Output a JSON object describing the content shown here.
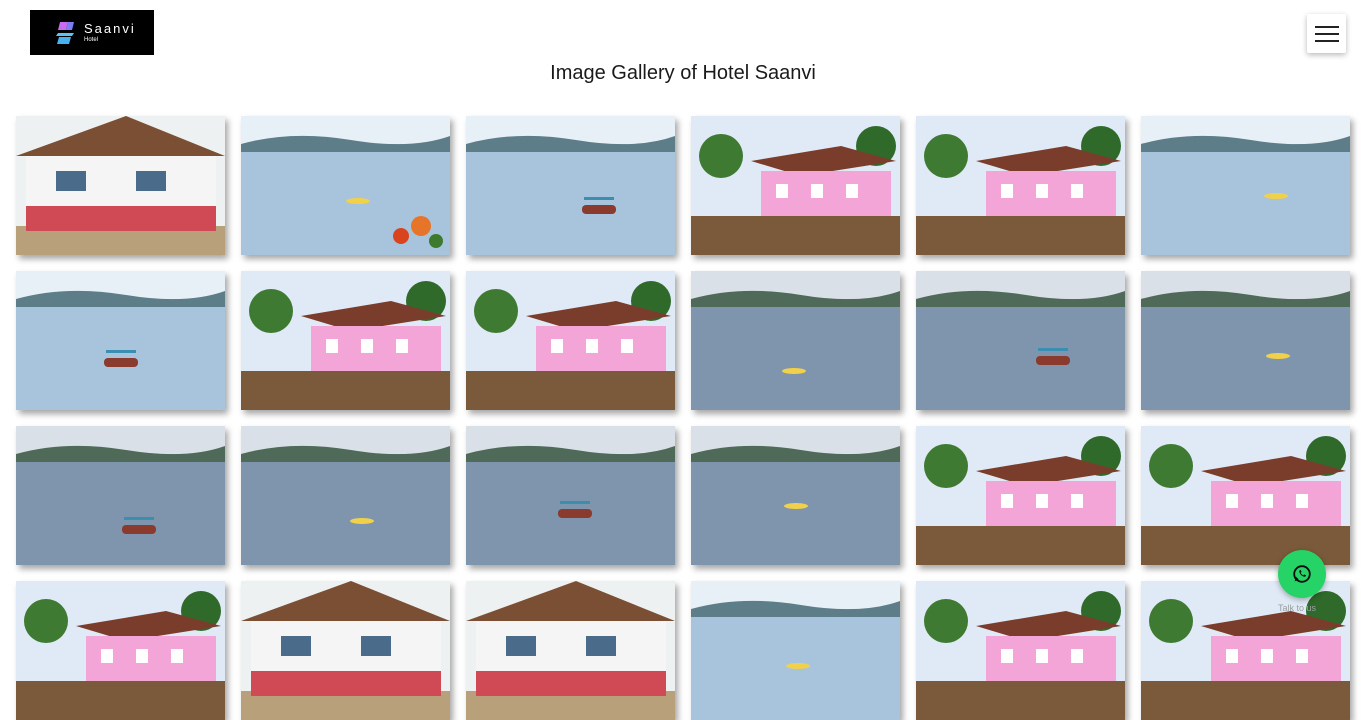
{
  "logo": {
    "name": "Saanvi",
    "sub": "Hotel"
  },
  "page_title": "Image Gallery of Hotel Saanvi",
  "menu_icon": "hamburger-menu-icon",
  "whatsapp": {
    "icon": "whatsapp-icon",
    "label": "Talk to us",
    "color": "#25d366"
  },
  "gallery": {
    "columns": 6,
    "photos": [
      "cafe-pavilion",
      "lake-flowers",
      "lake-kayak",
      "resort-cottages",
      "pink-cottage-row",
      "lake-boats",
      "lake-kayaks",
      "cottage-lakeview",
      "veranda-lakeview",
      "lake-plants",
      "lake-boat",
      "lake-boat-2",
      "lake-boats-2",
      "lake-boats-3",
      "lake-boats-4",
      "speedboat",
      "two-storey-cottage",
      "two-storey-cottage-2",
      "cottage-row",
      "restaurant-front",
      "restaurant-front-2",
      "lakeside-guest",
      "cottage-roof",
      "cottage-roof-2"
    ]
  }
}
